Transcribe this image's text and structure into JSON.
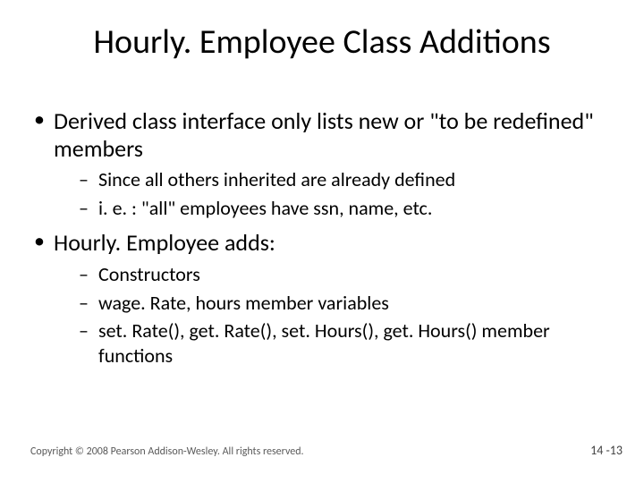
{
  "title": "Hourly. Employee Class Additions",
  "bullets": [
    {
      "text": "Derived class interface only lists new or \"to be redefined\" members",
      "sub": [
        "Since all others inherited are already defined",
        "i. e. : \"all\" employees have ssn, name, etc."
      ]
    },
    {
      "text": "Hourly. Employee adds:",
      "sub": [
        "Constructors",
        "wage. Rate, hours member variables",
        "set. Rate(), get. Rate(), set. Hours(), get. Hours() member functions"
      ]
    }
  ],
  "copyright": "Copyright © 2008 Pearson Addison-Wesley. All rights reserved.",
  "page_number": "14 -13"
}
